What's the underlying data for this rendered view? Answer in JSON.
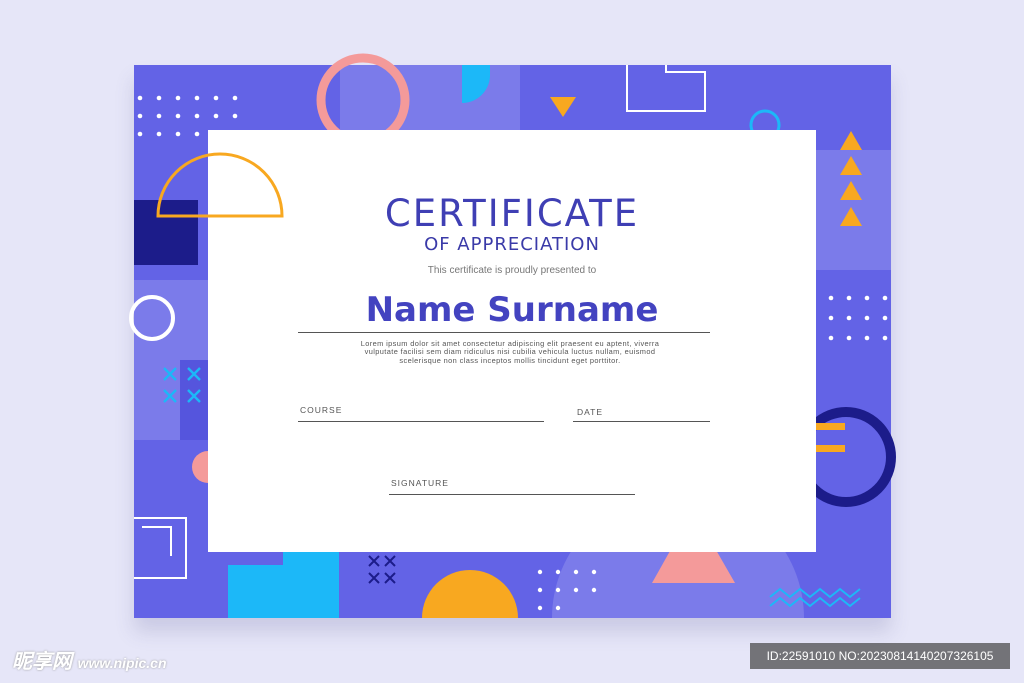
{
  "certificate": {
    "title": "CERTIFICATE",
    "subtitle": "OF APPRECIATION",
    "presented_text": "This certificate is proudly presented to",
    "recipient_name": "Name Surname",
    "body_text": "Lorem ipsum dolor sit amet consectetur adipiscing elit praesent eu aptent, viverra vulputate facilisi sem diam ridiculus nisi cubilia vehicula luctus nullam, euismod scelerisque non class inceptos mollis tincidunt eget porttitor.",
    "fields": {
      "course_label": "COURSE",
      "date_label": "DATE",
      "signature_label": "SIGNATURE"
    }
  },
  "watermark": {
    "site_logo_text": "昵享网",
    "site_url": "www.nipic.cn",
    "image_id": "ID:22591010 NO:20230814140207326105"
  },
  "colors": {
    "background": "#e6e6f8",
    "card": "#6363e6",
    "card_light": "#7b7bea",
    "dark_navy": "#1c1c8a",
    "cyan": "#1cb8f8",
    "orange": "#f8a820",
    "pink": "#f49a9a",
    "title_text": "#3f3fb4"
  }
}
